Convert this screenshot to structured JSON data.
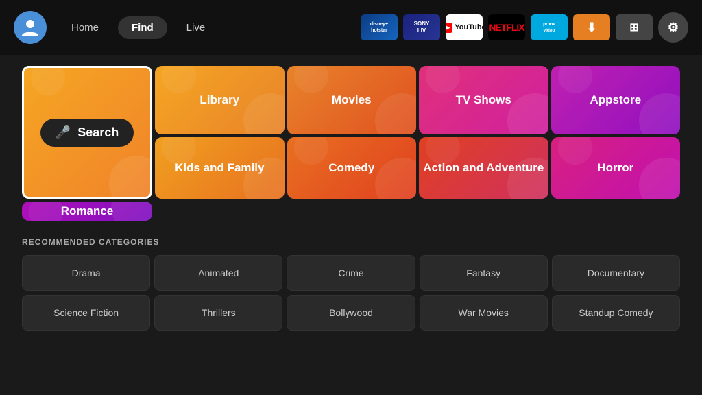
{
  "header": {
    "nav": [
      {
        "label": "Home",
        "active": false
      },
      {
        "label": "Find",
        "active": true
      },
      {
        "label": "Live",
        "active": false
      }
    ],
    "apps": [
      {
        "name": "Disney+ Hotstar",
        "key": "hotstar",
        "display": "disney+\nhotstar"
      },
      {
        "name": "Sony LIV",
        "key": "sonyliv",
        "display": "SONY\nLIV"
      },
      {
        "name": "YouTube",
        "key": "youtube",
        "display": "▶ YouTube"
      },
      {
        "name": "Netflix",
        "key": "netflix",
        "display": "NETFLIX"
      },
      {
        "name": "Prime Video",
        "key": "primevideo",
        "display": "prime\nvideo"
      },
      {
        "name": "Downloader",
        "key": "downloader",
        "display": "⬇"
      },
      {
        "name": "Multi Window",
        "key": "multi",
        "display": "⊞"
      },
      {
        "name": "Settings",
        "key": "settings",
        "display": "⚙"
      }
    ]
  },
  "categories": {
    "main": [
      {
        "label": "Search",
        "key": "search",
        "special": true
      },
      {
        "label": "Library",
        "key": "library"
      },
      {
        "label": "Movies",
        "key": "movies"
      },
      {
        "label": "TV Shows",
        "key": "tvshows"
      },
      {
        "label": "Appstore",
        "key": "appstore"
      },
      {
        "label": "Kids and Family",
        "key": "kids"
      },
      {
        "label": "Comedy",
        "key": "comedy"
      },
      {
        "label": "Action and Adventure",
        "key": "action"
      },
      {
        "label": "Horror",
        "key": "horror"
      },
      {
        "label": "Romance",
        "key": "romance"
      }
    ],
    "recommended_label": "RECOMMENDED CATEGORIES",
    "recommended": [
      {
        "label": "Drama"
      },
      {
        "label": "Animated"
      },
      {
        "label": "Crime"
      },
      {
        "label": "Fantasy"
      },
      {
        "label": "Documentary"
      },
      {
        "label": "Science Fiction"
      },
      {
        "label": "Thrillers"
      },
      {
        "label": "Bollywood"
      },
      {
        "label": "War Movies"
      },
      {
        "label": "Standup Comedy"
      }
    ]
  }
}
